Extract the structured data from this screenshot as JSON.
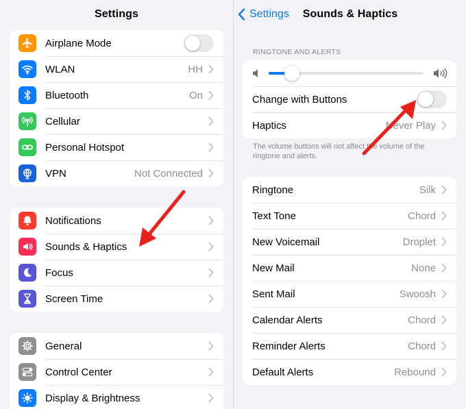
{
  "left": {
    "title": "Settings",
    "group1": [
      {
        "label": "Airplane Mode",
        "icon": "airplane-icon",
        "color": "#ff9500",
        "toggle": false,
        "value": ""
      },
      {
        "label": "WLAN",
        "icon": "wifi-icon",
        "color": "#0a7aff",
        "value": "HH"
      },
      {
        "label": "Bluetooth",
        "icon": "bluetooth-icon",
        "color": "#0a7aff",
        "value": "On"
      },
      {
        "label": "Cellular",
        "icon": "antenna-icon",
        "color": "#34c759",
        "value": ""
      },
      {
        "label": "Personal Hotspot",
        "icon": "link-icon",
        "color": "#34c759",
        "value": ""
      },
      {
        "label": "VPN",
        "icon": "globe-icon",
        "color": "#1a62d8",
        "value": "Not Connected"
      }
    ],
    "group2": [
      {
        "label": "Notifications",
        "icon": "bell-icon",
        "color": "#ff3b30",
        "value": ""
      },
      {
        "label": "Sounds & Haptics",
        "icon": "speaker-icon",
        "color": "#ff2d55",
        "value": ""
      },
      {
        "label": "Focus",
        "icon": "moon-icon",
        "color": "#5856d6",
        "value": ""
      },
      {
        "label": "Screen Time",
        "icon": "hourglass-icon",
        "color": "#5856d6",
        "value": ""
      }
    ],
    "group3": [
      {
        "label": "General",
        "icon": "gear-icon",
        "color": "#8e8e93",
        "value": ""
      },
      {
        "label": "Control Center",
        "icon": "switches-icon",
        "color": "#8e8e93",
        "value": ""
      },
      {
        "label": "Display & Brightness",
        "icon": "sun-icon",
        "color": "#0a7aff",
        "value": ""
      }
    ]
  },
  "right": {
    "back_label": "Settings",
    "title": "Sounds & Haptics",
    "section_header": "RINGTONE AND ALERTS",
    "volume_level": 0.15,
    "change_with_buttons": {
      "label": "Change with Buttons",
      "toggle": false
    },
    "haptics": {
      "label": "Haptics",
      "value": "Never Play"
    },
    "footer": "The volume buttons will not affect the volume of the ringtone and alerts.",
    "tones": [
      {
        "label": "Ringtone",
        "value": "Silk"
      },
      {
        "label": "Text Tone",
        "value": "Chord"
      },
      {
        "label": "New Voicemail",
        "value": "Droplet"
      },
      {
        "label": "New Mail",
        "value": "None"
      },
      {
        "label": "Sent Mail",
        "value": "Swoosh"
      },
      {
        "label": "Calendar Alerts",
        "value": "Chord"
      },
      {
        "label": "Reminder Alerts",
        "value": "Chord"
      },
      {
        "label": "Default Alerts",
        "value": "Rebound"
      }
    ]
  },
  "annotation_color": "#e8221a"
}
